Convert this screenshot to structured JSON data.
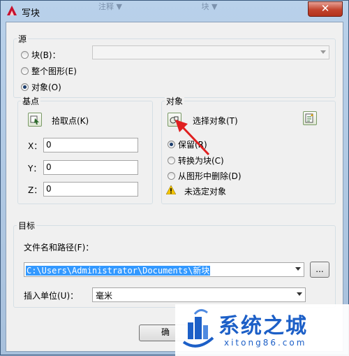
{
  "window": {
    "title": "写块",
    "close_label": "✕",
    "ghost_tabs": [
      "注释 ▼",
      "块 ▼"
    ]
  },
  "source": {
    "label": "源",
    "options": [
      "块(B)：",
      "整个图形(E)",
      "对象(O)"
    ],
    "selected": "对象(O)",
    "block_combo_value": ""
  },
  "base_point": {
    "label": "基点",
    "pick_label": "拾取点(K)",
    "x_label": "X：",
    "y_label": "Y：",
    "z_label": "Z：",
    "x_value": "0",
    "y_value": "0",
    "z_value": "0"
  },
  "objects": {
    "label": "对象",
    "select_label": "选择对象(T)",
    "options": [
      "保留(R)",
      "转换为块(C)",
      "从图形中删除(D)"
    ],
    "selected": "保留(R)",
    "warning": "未选定对象"
  },
  "target": {
    "label": "目标",
    "path_label": "文件名和路径(F)：",
    "path_value": "C:\\Users\\Administrator\\Documents\\新块",
    "browse_label": "...",
    "units_label": "插入单位(U)：",
    "units_value": "毫米"
  },
  "footer": {
    "ok_label": "确"
  },
  "watermark": {
    "text": "系统之城",
    "sub": "xitong86.com"
  },
  "colors": {
    "accent": "#1c5fc7",
    "selection": "#3399ff",
    "annotation_arrow": "#e02020"
  }
}
